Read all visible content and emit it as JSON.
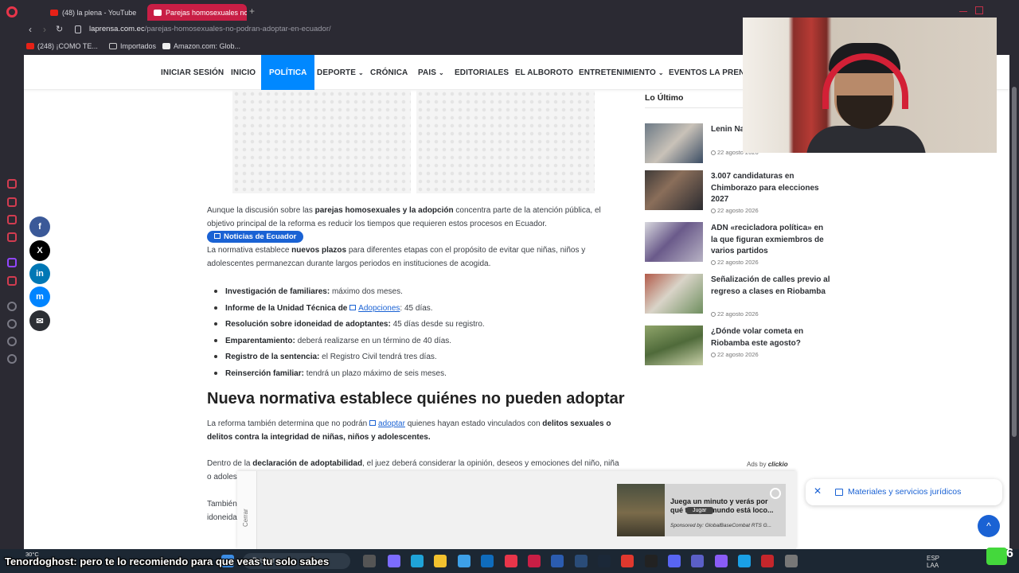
{
  "browser": {
    "tabs": [
      {
        "label": "(48) la plena - YouTube",
        "active": false
      },
      {
        "label": "Parejas homosexuales no p",
        "active": true
      }
    ],
    "url_domain": "laprensa.com.ec",
    "url_path": "/parejas-homosexuales-no-podran-adoptar-en-ecuador/",
    "bookmarks": [
      "(248) ¡COMO TE...",
      "Importados",
      "Amazon.com: Glob..."
    ]
  },
  "site_nav": {
    "items": [
      "INICIAR SESIÓN",
      "INICIO",
      "POLÍTICA",
      "DEPORTE",
      "CRÓNICA",
      "PAIS",
      "EDITORIALES",
      "EL ALBOROTO",
      "ENTRETENIMIENTO",
      "EVENTOS LA PRENSA"
    ],
    "chevron": "⌄"
  },
  "article": {
    "p1_a": "Aunque la discusión sobre las ",
    "p1_b": "parejas homosexuales y la adopción",
    "p1_c": " concentra parte de la atención pública, el objetivo principal de la reforma es reducir los tiempos que requieren estos procesos en Ecuador.",
    "pill": "Noticias de Ecuador",
    "p2_a": "La normativa establece ",
    "p2_b": "nuevos plazos",
    "p2_c": " para diferentes etapas con el propósito de evitar que niñas, niños y adolescentes permanezcan durante largos periodos en instituciones de acogida.",
    "bullets": [
      {
        "bold": "Investigación de familiares:",
        "text": " máximo dos meses."
      },
      {
        "bold": "Informe de la Unidad Técnica de ",
        "link": "Adopciones",
        "text": ": 45 días."
      },
      {
        "bold": "Resolución sobre idoneidad de adoptantes:",
        "text": " 45 días desde su registro."
      },
      {
        "bold": "Emparentamiento:",
        "text": " deberá realizarse en un término de 40 días."
      },
      {
        "bold": "Registro de la sentencia:",
        "text": " el Registro Civil tendrá tres días."
      },
      {
        "bold": "Reinserción familiar:",
        "text": " tendrá un plazo máximo de seis meses."
      }
    ],
    "h2": "Nueva normativa establece quiénes no pueden adoptar",
    "p3_a": "La reforma también determina que no podrán ",
    "p3_link": "adoptar",
    "p3_b": " quienes hayan estado vinculados con ",
    "p3_c": "delitos sexuales o delitos contra la integridad de niñas, niños y adolescentes.",
    "p4_a": "Dentro de la ",
    "p4_b": "declaración de adoptabilidad",
    "p4_c": ", el juez deberá considerar la opinión, deseos y emociones del niño, niña o adolesce",
    "p5_a": "También",
    "p5_b": "idoneida"
  },
  "sidebar": {
    "title": "Lo Último",
    "items": [
      {
        "title": "Lenin Na... concejal",
        "date": "22 agosto 2026"
      },
      {
        "title": "3.007 candidaturas en Chimborazo para elecciones 2027",
        "date": "22 agosto 2026"
      },
      {
        "title": "ADN «recicladora política» en la que figuran exmiembros de varios partidos",
        "date": "22 agosto 2026"
      },
      {
        "title": "Señalización de calles previo al regreso a clases en Riobamba",
        "date": "22 agosto 2026"
      },
      {
        "title": "¿Dónde volar cometa en Riobamba este agosto?",
        "date": "22 agosto 2026"
      }
    ]
  },
  "share": {
    "labels": [
      "f",
      "X",
      "in",
      "m",
      "✉"
    ],
    "colors": [
      "#3b5998",
      "#000000",
      "#0077b5",
      "#0084ff",
      "#2c2f34"
    ]
  },
  "ad": {
    "close_label": "Cerrar",
    "ads_by": "Ads by",
    "ads_brand": "clickio",
    "text": "Juega un minuto y verás por qué todo el mundo está loco...",
    "play": "Jugar",
    "sponsor": "Sponsored by: GlobalBaseCombat RTS G..."
  },
  "chip": {
    "close": "✕",
    "label": "Materiales y servicios jurídicos"
  },
  "to_top": "^",
  "taskbar": {
    "weather_temp": "30°C",
    "search": "Buscar",
    "lang_top": "ESP",
    "lang_bottom": "LAA",
    "badge_number": "6"
  },
  "stream_caption": "Tenordoghost: pero te lo recomiendo para que veas tu solo sabes"
}
